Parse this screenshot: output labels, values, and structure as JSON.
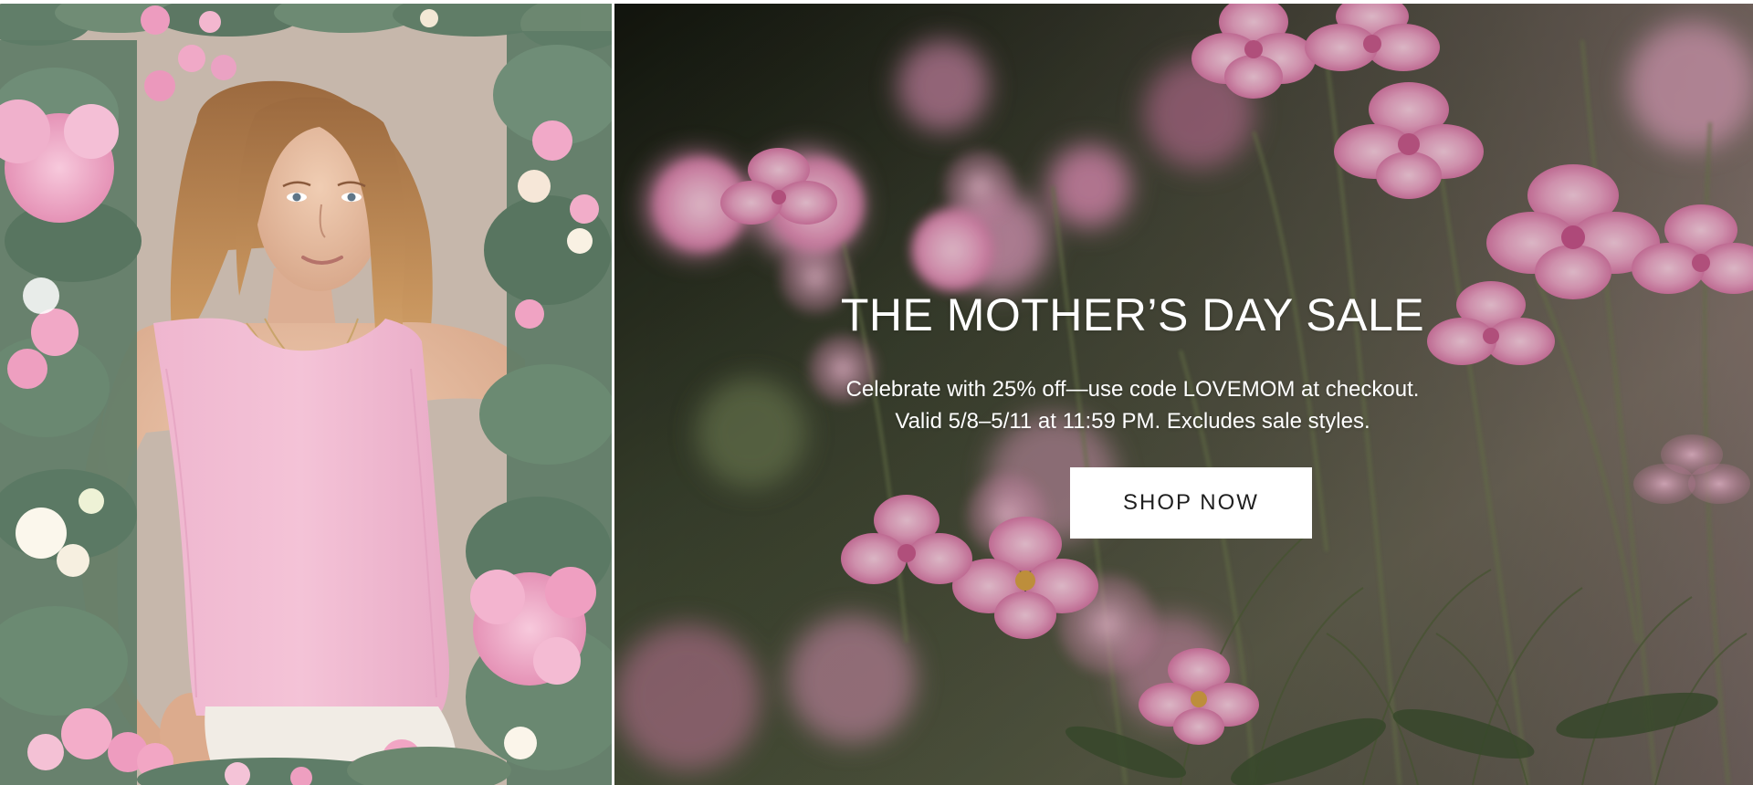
{
  "promo": {
    "title": "THE MOTHER’S DAY SALE",
    "description_line1": "Celebrate with 25% off—use code LOVEMOM at checkout.",
    "description_line2": "Valid 5/8–5/11 at 11:59 PM. Excludes sale styles.",
    "cta_label": "SHOP NOW"
  },
  "colors": {
    "cta_background": "#ffffff",
    "cta_text": "#1f1f1f",
    "headline_text": "#ffffff",
    "top_color": "#f2a3c6",
    "flower_pink": "#e9a8c8",
    "foliage_green": "#5f7d68"
  },
  "images": {
    "left": "model-with-floral-frame",
    "right": "pink-anemone-flower-field"
  }
}
